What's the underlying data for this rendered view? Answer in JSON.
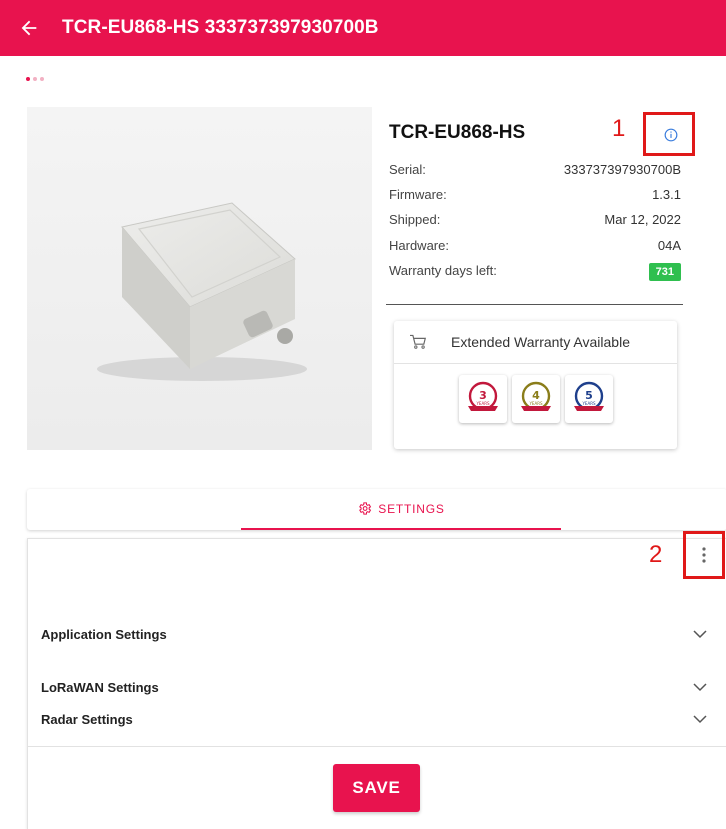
{
  "header": {
    "title": "TCR-EU868-HS 333737397930700B",
    "background": "#e8134e",
    "back_icon": "arrow-left-icon"
  },
  "device": {
    "name": "TCR-EU868-HS",
    "specs": [
      {
        "label": "Serial:",
        "value": "333737397930700B"
      },
      {
        "label": "Firmware:",
        "value": "1.3.1"
      },
      {
        "label": "Shipped:",
        "value": "Mar 12, 2022"
      },
      {
        "label": "Hardware:",
        "value": "04A"
      }
    ],
    "warranty_label": "Warranty days left:",
    "warranty_days": "731"
  },
  "annotations": {
    "info_marker": "1",
    "menu_marker": "2"
  },
  "warranty_card": {
    "title": "Extended Warranty Available",
    "badges": [
      {
        "number": "3",
        "unit": "YEARS",
        "color": "#c2183c"
      },
      {
        "number": "4",
        "unit": "YEARS",
        "color": "#8a7d1a"
      },
      {
        "number": "5",
        "unit": "YEARS",
        "color": "#1e3f8c"
      }
    ]
  },
  "tabs": [
    {
      "label": "SETTINGS",
      "icon": "gear-icon",
      "active": true
    }
  ],
  "settings": [
    {
      "label": "Application Settings"
    },
    {
      "label": "LoRaWAN Settings"
    },
    {
      "label": "Radar Settings"
    }
  ],
  "actions": {
    "save_label": "SAVE"
  },
  "colors": {
    "accent": "#e8134e",
    "badge_green": "#2fbf4f",
    "annotation_red": "#e01818",
    "info_blue": "#3b7ddd"
  }
}
